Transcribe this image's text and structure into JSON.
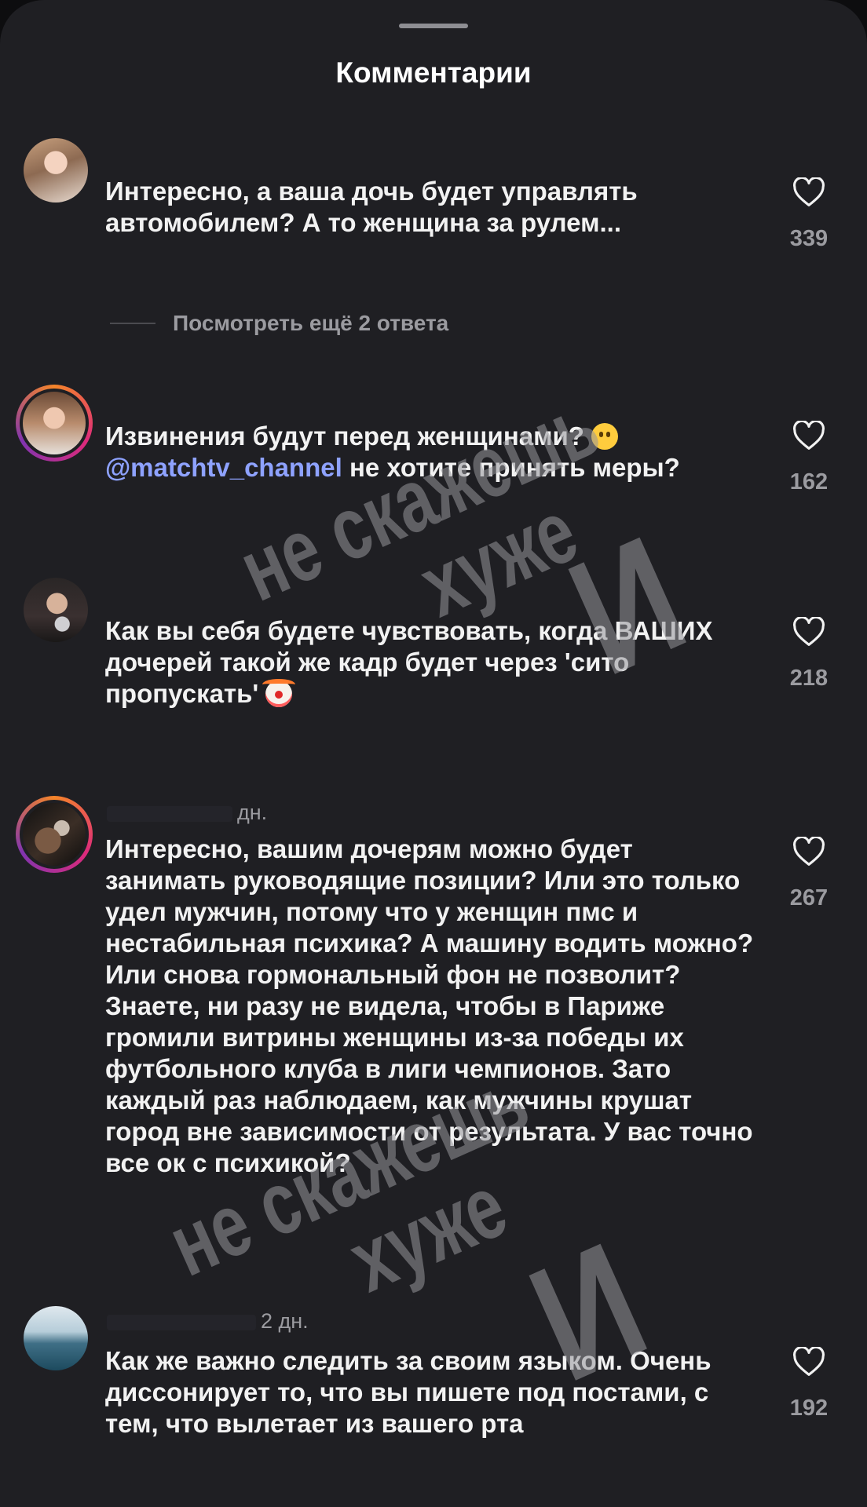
{
  "sheet": {
    "title": "Комментарии"
  },
  "comments": [
    {
      "avatar": "avatar-photo-woman",
      "time": "",
      "text_parts": [
        "Интересно, а ваша дочь будет управлять автомобилем? А то женщина за рулем..."
      ],
      "likes": "339",
      "more_replies": "Посмотреть ещё 2 ответа"
    },
    {
      "avatar": "avatar-photo-woman-story",
      "time": "",
      "text_before_emoji": "Извинения будут перед женщинами?",
      "emoji": "slightly-smiling-face",
      "mention": "@matchtv_channel",
      "text_after_mention": " не хотите принять меры?",
      "likes": "162"
    },
    {
      "avatar": "avatar-photo-selfie",
      "time": "",
      "text": "Как вы себя будете чувствовать, когда ВАШИХ дочерей такой же кадр будет через 'сито пропускать'",
      "emoji": "clown-face",
      "likes": "218"
    },
    {
      "avatar": "avatar-photo-dark-story",
      "time": "дн.",
      "text": "Интересно, вашим дочерям можно будет занимать руководящие позиции? Или это только удел мужчин, потому что у женщин пмс и нестабильная психика? А машину водить можно? Или снова гормональный фон не позволит? Знаете, ни разу не видела, чтобы в Париже громили витрины женщины из-за победы их футбольного клуба в лиги чемпионов. Зато каждый раз наблюдаем, как мужчины крушат город вне зависимости от результата. У вас точно все ок с психикой?",
      "likes": "267"
    },
    {
      "avatar": "avatar-photo-pool",
      "time": "2 дн.",
      "text": "Как же важно следить за своим языком. Очень диссонирует то, что вы пишете под постами, с тем, что вылетает из вашего рта",
      "likes": "192"
    }
  ],
  "watermark": {
    "line1": "хуже",
    "line2": "не скажешь",
    "line3": "И"
  },
  "colors": {
    "background": "#1f1f23",
    "text": "#f2f2f2",
    "secondary": "#9b9ba0",
    "mention": "#8ea2ff",
    "story_ring": "#dd2a7b"
  }
}
